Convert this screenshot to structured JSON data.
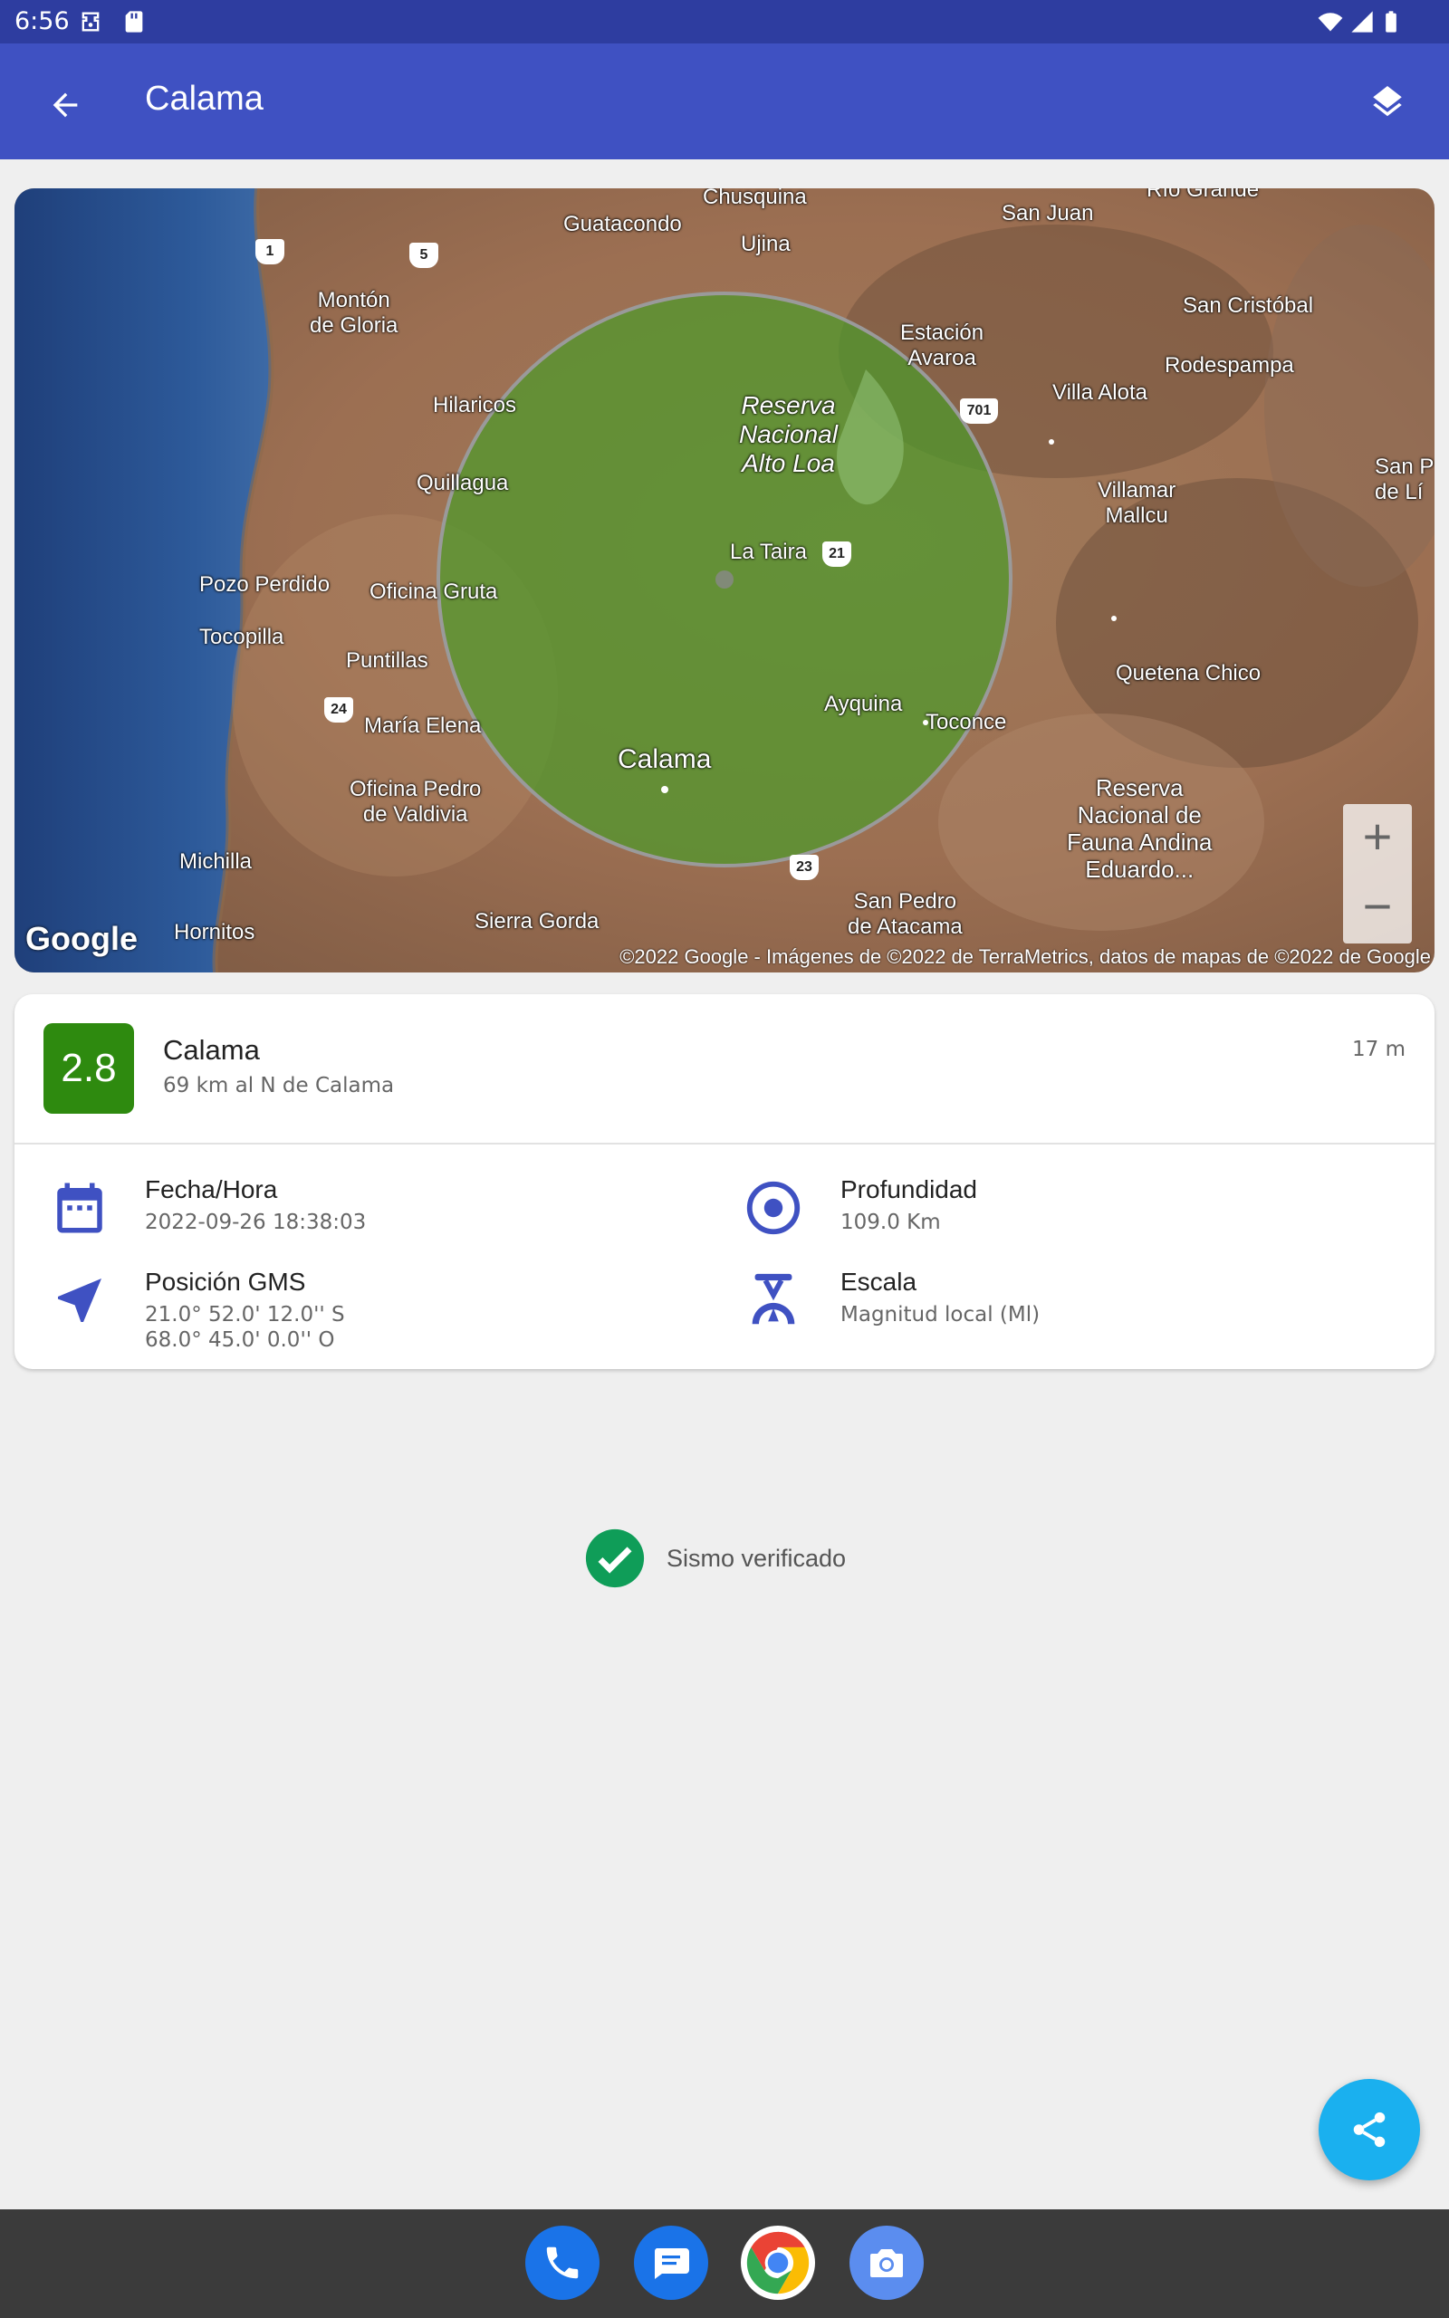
{
  "status_bar": {
    "time": "6:56",
    "icons": [
      "vpn-key-icon",
      "sd-card-icon",
      "wifi-icon",
      "cell-signal-icon",
      "battery-icon"
    ]
  },
  "app_bar": {
    "title": "Calama",
    "back_icon": "arrow-back-icon",
    "layers_icon": "layers-icon"
  },
  "map": {
    "labels": {
      "chusquina": "Chusquina",
      "rio_grande": "Río Grande",
      "guatacondo": "Guatacondo",
      "ujina": "Ujina",
      "san_juan": "San Juan",
      "monton_de_gloria": "Montón\nde Gloria",
      "estacion_avaroa": "Estación\nAvaroa",
      "san_cristobal": "San Cristóbal",
      "rodespampa": "Rodespampa",
      "hilaricos": "Hilaricos",
      "villa_alota": "Villa Alota",
      "reserva_alto_loa": "Reserva\nNacional\nAlto Loa",
      "san_p_de_li": "San P\nde Lí",
      "quillagua": "Quillagua",
      "villamar_mallcu": "Villamar\nMallcu",
      "la_taira": "La Taira",
      "pozo_perdido": "Pozo Perdido",
      "oficina_gruta": "Oficina Gruta",
      "tocopilla": "Tocopilla",
      "puntillas": "Puntillas",
      "quetena_chico": "Quetena Chico",
      "ayquina": "Ayquina",
      "toconce": "Toconce",
      "maria_elena": "María Elena",
      "calama": "Calama",
      "reserva_fauna": "Reserva\nNacional de\nFauna Andina\nEduardo...",
      "oficina_pedro": "Oficina Pedro\nde Valdivia",
      "michilla": "Michilla",
      "san_pedro": "San Pedro\nde Atacama",
      "sierra_gorda": "Sierra Gorda",
      "hornitos": "Hornitos"
    },
    "road_shields": {
      "r1": "1",
      "r5": "5",
      "r701": "701",
      "r21": "21",
      "r24": "24",
      "r23": "23"
    },
    "zoom_in": "+",
    "zoom_out": "−",
    "logo": "Google",
    "attribution": "©2022 Google - Imágenes de ©2022 de TerraMetrics, datos de mapas de ©2022 de Google"
  },
  "event": {
    "magnitude": "2.8",
    "magnitude_color": "#2e8a0f",
    "title": "Calama",
    "subtitle": "69 km al N de Calama",
    "time_ago": "17 m",
    "date_label": "Fecha/Hora",
    "date_value": "2022-09-26 18:38:03",
    "depth_label": "Profundidad",
    "depth_value": "109.0 Km",
    "position_label": "Posición GMS",
    "position_lat": "21.0° 52.0' 12.0'' S",
    "position_lon": "68.0° 45.0' 0.0'' O",
    "scale_label": "Escala",
    "scale_value": "Magnitud local (Ml)"
  },
  "verified": {
    "text": "Sismo verificado",
    "color": "#0f9d58"
  },
  "accent_color": "#3f51c2",
  "fab": {
    "icon": "share-icon",
    "color": "#1ab0ef"
  },
  "dock": [
    "phone-app-icon",
    "messages-app-icon",
    "chrome-app-icon",
    "camera-app-icon"
  ]
}
